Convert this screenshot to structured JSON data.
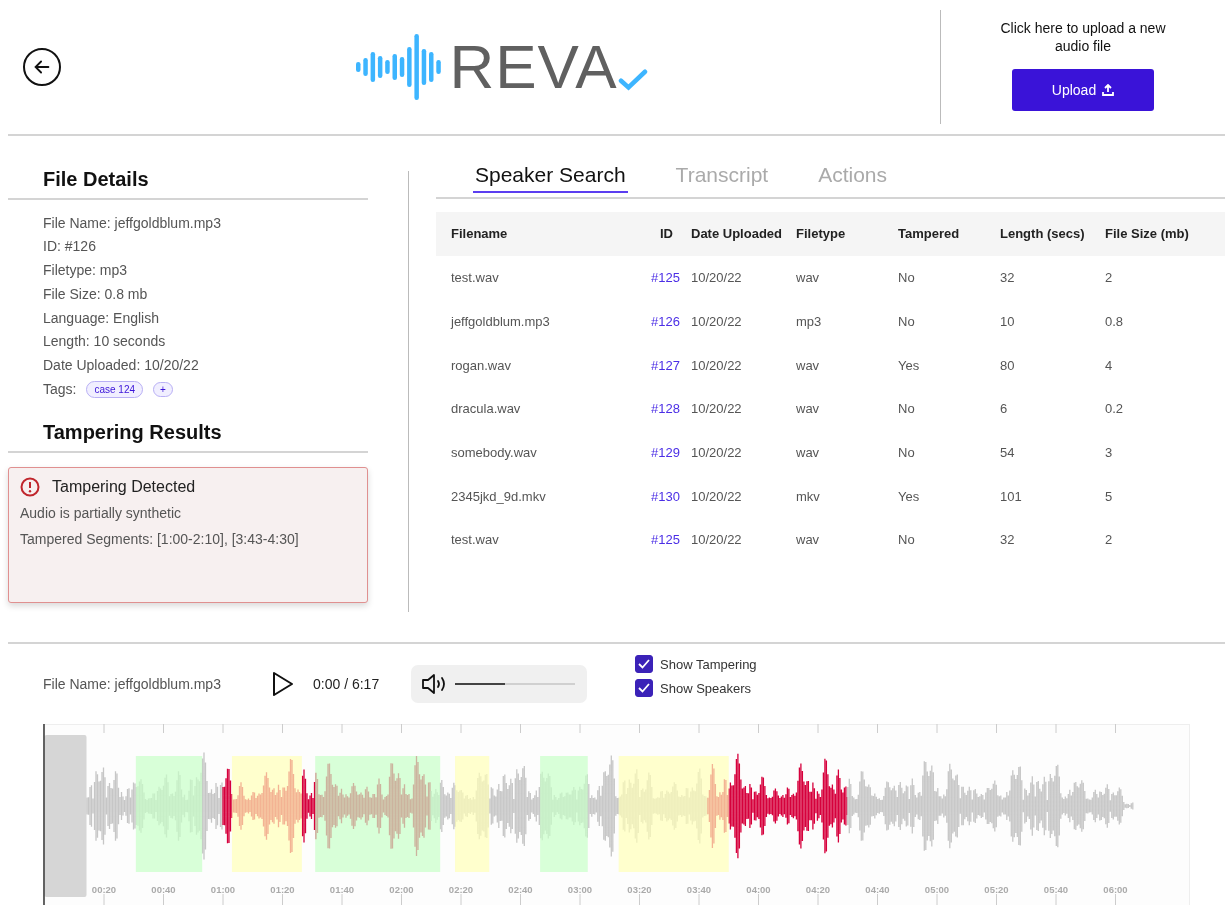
{
  "header": {
    "logo": "REVA",
    "upload_prompt": "Click here to upload a new audio file",
    "upload_button": "Upload"
  },
  "file_details": {
    "title": "File Details",
    "lines": [
      "File Name: jeffgoldblum.mp3",
      "ID: #126",
      "Filetype: mp3",
      "File Size: 0.8 mb",
      "Language: English",
      "Length: 10 seconds",
      "Date Uploaded: 10/20/22"
    ],
    "tags_label": "Tags:",
    "tags": [
      "case 124"
    ],
    "add_tag": "+"
  },
  "tampering": {
    "title": "Tampering Results",
    "alert": {
      "title": "Tampering Detected",
      "lines": [
        "Audio is partially synthetic",
        "Tampered Segments: [1:00-2:10], [3:43-4:30]"
      ]
    }
  },
  "tabs": [
    {
      "label": "Speaker Search",
      "selected": true
    },
    {
      "label": "Transcript",
      "selected": false
    },
    {
      "label": "Actions",
      "selected": false
    }
  ],
  "table": {
    "columns": [
      {
        "label": "Filename",
        "kind": "text"
      },
      {
        "label": "ID",
        "kind": "link"
      },
      {
        "label": "Date Uploaded",
        "kind": "text"
      },
      {
        "label": "Filetype",
        "kind": "text"
      },
      {
        "label": "Tampered",
        "kind": "text"
      },
      {
        "label": "Length (secs)",
        "kind": "text"
      },
      {
        "label": "File Size (mb)",
        "kind": "text"
      }
    ],
    "rows": [
      [
        "test.wav",
        "#125",
        "10/20/22",
        "wav",
        "No",
        "32",
        "2"
      ],
      [
        "jeffgoldblum.mp3",
        "#126",
        "10/20/22",
        "mp3",
        "No",
        "10",
        "0.8"
      ],
      [
        "rogan.wav",
        "#127",
        "10/20/22",
        "wav",
        "Yes",
        "80",
        "4"
      ],
      [
        "dracula.wav",
        "#128",
        "10/20/22",
        "wav",
        "No",
        "6",
        "0.2"
      ],
      [
        "somebody.wav",
        "#129",
        "10/20/22",
        "wav",
        "No",
        "54",
        "3"
      ],
      [
        "2345jkd_9d.mkv",
        "#130",
        "10/20/22",
        "mkv",
        "Yes",
        "101",
        "5"
      ],
      [
        "test.wav",
        "#125",
        "10/20/22",
        "wav",
        "No",
        "32",
        "2"
      ]
    ]
  },
  "player": {
    "file_name": "File Name: jeffgoldblum.mp3",
    "time": "0:00 / 6:17",
    "volume": {
      "level": 0.42
    },
    "options": [
      {
        "label": "Show Tampering",
        "checked": true
      },
      {
        "label": "Show Speakers",
        "checked": true
      }
    ],
    "time_ticks": [
      "00:20",
      "00:40",
      "01:00",
      "01:20",
      "01:40",
      "02:00",
      "02:20",
      "02:40",
      "03:00",
      "03:20",
      "03:40",
      "04:00",
      "04:20",
      "04:40",
      "05:00",
      "05:20",
      "05:40",
      "06:00"
    ]
  }
}
